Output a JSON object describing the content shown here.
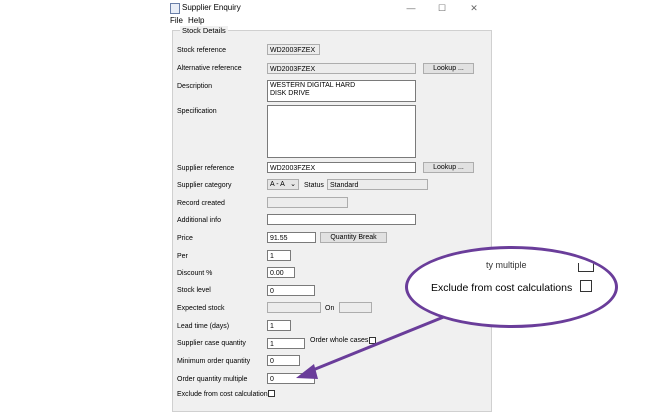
{
  "window": {
    "title": "Supplier Enquiry",
    "minimize_glyph": "—",
    "maximize_glyph": "☐",
    "close_glyph": "✕",
    "menu": [
      "File",
      "Help"
    ]
  },
  "group_title": "Stock Details",
  "fields": {
    "stock_reference": {
      "label": "Stock reference",
      "value": "WD2003FZEX"
    },
    "alternative_reference": {
      "label": "Alternative reference",
      "value": "WD2003FZEX"
    },
    "description": {
      "label": "Description",
      "value": "WESTERN DIGITAL HARD DISK DRIVE"
    },
    "specification": {
      "label": "Specification",
      "value": ""
    },
    "supplier_reference": {
      "label": "Supplier reference",
      "value": "WD2003FZEX"
    },
    "supplier_category": {
      "label": "Supplier category",
      "value": "A - A"
    },
    "status": {
      "label": "Status",
      "value": "Standard"
    },
    "record_created": {
      "label": "Record created",
      "value": ""
    },
    "additional_info": {
      "label": "Additional info",
      "value": ""
    },
    "price": {
      "label": "Price",
      "value": "91.55"
    },
    "per": {
      "label": "Per",
      "value": "1"
    },
    "discount": {
      "label": "Discount %",
      "value": "0.00"
    },
    "stock_level": {
      "label": "Stock level",
      "value": "0"
    },
    "expected_stock": {
      "label": "Expected stock",
      "value": ""
    },
    "on": {
      "label": "On",
      "value": ""
    },
    "lead_time": {
      "label": "Lead time (days)",
      "value": "1"
    },
    "supplier_case_quantity": {
      "label": "Supplier case quantity",
      "value": "1"
    },
    "order_whole_cases": {
      "label": "Order whole cases"
    },
    "minimum_order_quantity": {
      "label": "Minimum order quantity",
      "value": "0"
    },
    "order_quantity_multiple": {
      "label": "Order quantity multiple",
      "value": "0"
    },
    "exclude_from_cost": {
      "label": "Exclude from cost calculations"
    }
  },
  "buttons": {
    "lookup": "Lookup ...",
    "quantity_break": "Quantity Break"
  },
  "callout": {
    "peek_text": "ty multiple",
    "label": "Exclude from cost calculations",
    "border_color": "#6a3d9a"
  }
}
